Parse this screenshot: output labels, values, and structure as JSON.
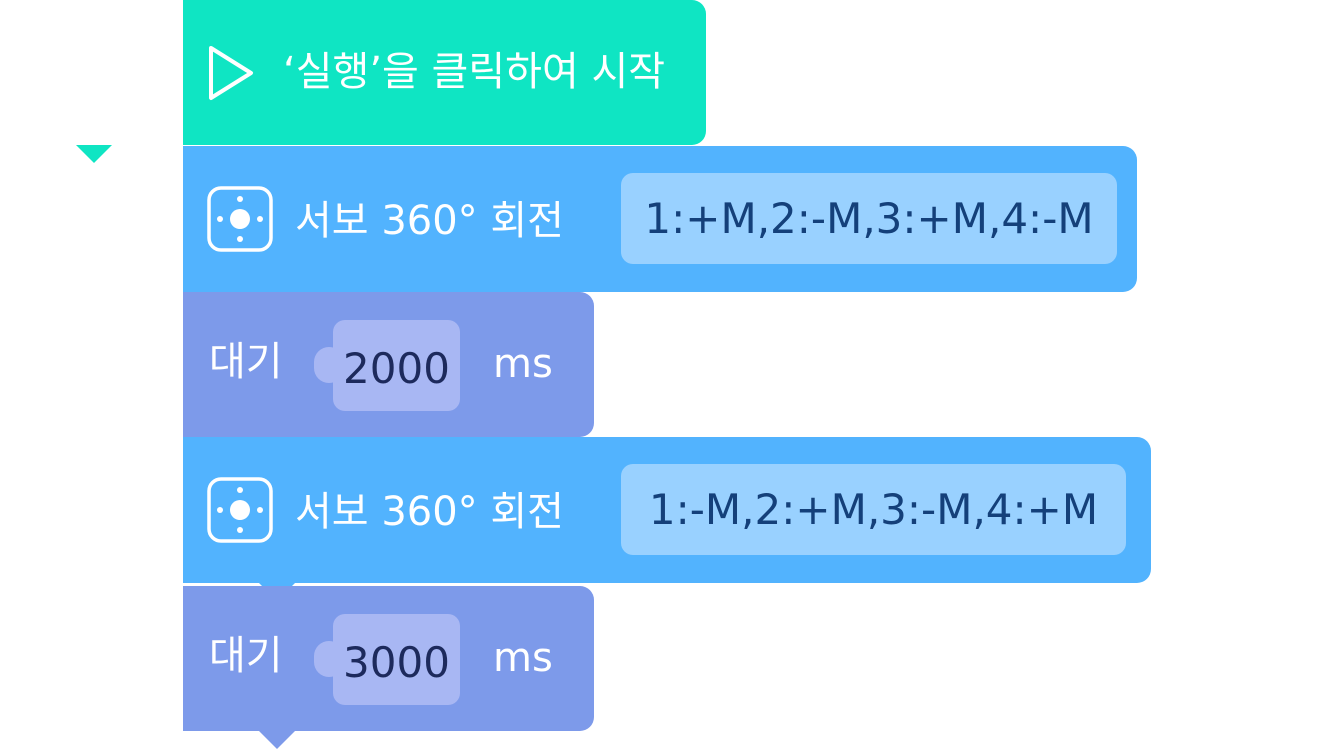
{
  "start_block": {
    "label": "‘실행’을 클릭하여 시작",
    "icon": "play-icon",
    "color": "#0fe5c3"
  },
  "blocks": [
    {
      "type": "servo",
      "label": "서보 360° 회전",
      "icon": "servo-icon",
      "value": "1:+M,2:-M,3:+M,4:-M",
      "color": "#52b3fe"
    },
    {
      "type": "wait",
      "label": "대기",
      "value": "2000",
      "unit": "ms",
      "color": "#7d9aea"
    },
    {
      "type": "servo",
      "label": "서보 360° 회전",
      "icon": "servo-icon",
      "value": "1:-M,2:+M,3:-M,4:+M",
      "color": "#52b3fe"
    },
    {
      "type": "wait",
      "label": "대기",
      "value": "3000",
      "unit": "ms",
      "color": "#7d9aea"
    }
  ]
}
